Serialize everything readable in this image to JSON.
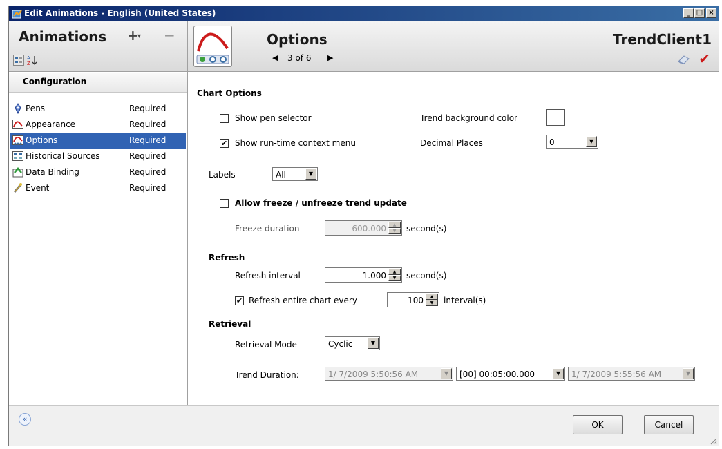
{
  "window": {
    "title": "Edit Animations - English (United States)"
  },
  "left": {
    "title": "Animations",
    "add_symbol": "+",
    "add_dropdown": "▾",
    "remove_symbol": "−",
    "section": "Configuration",
    "items": [
      {
        "name": "Pens",
        "status": "Required",
        "icon": "pen-icon"
      },
      {
        "name": "Appearance",
        "status": "Required",
        "icon": "appearance-icon"
      },
      {
        "name": "Options",
        "status": "Required",
        "icon": "options-icon",
        "selected": true
      },
      {
        "name": "Historical Sources",
        "status": "Required",
        "icon": "historical-sources-icon"
      },
      {
        "name": "Data Binding",
        "status": "Required",
        "icon": "data-binding-icon"
      },
      {
        "name": "Event",
        "status": "Required",
        "icon": "event-icon"
      }
    ],
    "collapse_glyph": "«"
  },
  "header": {
    "title": "Options",
    "pager": "3 of 6",
    "prev_glyph": "◀",
    "next_glyph": "▶",
    "client": "TrendClient1",
    "confirm_glyph": "✔"
  },
  "form": {
    "chart_options": "Chart Options",
    "show_pen_selector": {
      "label": "Show pen selector",
      "checked": false
    },
    "trend_bg_label": "Trend background color",
    "show_context_menu": {
      "label": "Show run-time context menu",
      "checked": true,
      "check_glyph": "✔"
    },
    "decimal_places_label": "Decimal Places",
    "decimal_places_value": "0",
    "labels_label": "Labels",
    "labels_value": "All",
    "allow_freeze": {
      "label": "Allow freeze / unfreeze trend update",
      "checked": false
    },
    "freeze_duration_label": "Freeze duration",
    "freeze_duration_value": "600.000",
    "seconds_unit": "second(s)",
    "refresh": "Refresh",
    "refresh_interval_label": "Refresh interval",
    "refresh_interval_value": "1.000",
    "refresh_entire": {
      "label": "Refresh entire chart every",
      "checked": true,
      "check_glyph": "✔"
    },
    "refresh_entire_value": "100",
    "intervals_unit": "interval(s)",
    "retrieval": "Retrieval",
    "retrieval_mode_label": "Retrieval Mode",
    "retrieval_mode_value": "Cyclic",
    "trend_duration_label": "Trend Duration:",
    "trend_start": "1/ 7/2009  5:50:56 AM",
    "trend_duration": "[00] 00:05:00.000",
    "trend_end": "1/ 7/2009  5:55:56 AM"
  },
  "footer": {
    "ok": "OK",
    "cancel": "Cancel"
  },
  "colors": {
    "titlebar": "#0a246a",
    "selection": "#3163b3",
    "confirm": "#cc1b1b"
  }
}
